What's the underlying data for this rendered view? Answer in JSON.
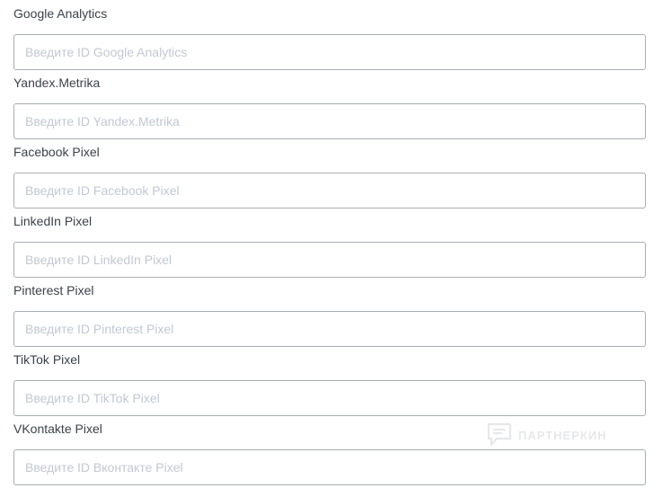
{
  "fields": [
    {
      "label": "Google Analytics",
      "value": "",
      "placeholder": "Введите ID Google Analytics"
    },
    {
      "label": "Yandex.Metrika",
      "value": "",
      "placeholder": "Введите ID Yandex.Metrika"
    },
    {
      "label": "Facebook Pixel",
      "value": "",
      "placeholder": "Введите ID Facebook Pixel"
    },
    {
      "label": "LinkedIn Pixel",
      "value": "",
      "placeholder": "Введите ID LinkedIn Pixel"
    },
    {
      "label": "Pinterest Pixel",
      "value": "",
      "placeholder": "Введите ID Pinterest Pixel"
    },
    {
      "label": "TikTok Pixel",
      "value": "",
      "placeholder": "Введите ID TikTok Pixel"
    },
    {
      "label": "VKontakte Pixel",
      "value": "",
      "placeholder": "Введите ID Вконтакте Pixel"
    }
  ],
  "watermark": {
    "text": "ПАРТНЕРКИН",
    "icon": "partnerkin-logo"
  },
  "colors": {
    "label_text": "#3c4248",
    "input_border": "#a9adb2",
    "placeholder_text": "#c2c8d2",
    "background": "#ffffff"
  }
}
